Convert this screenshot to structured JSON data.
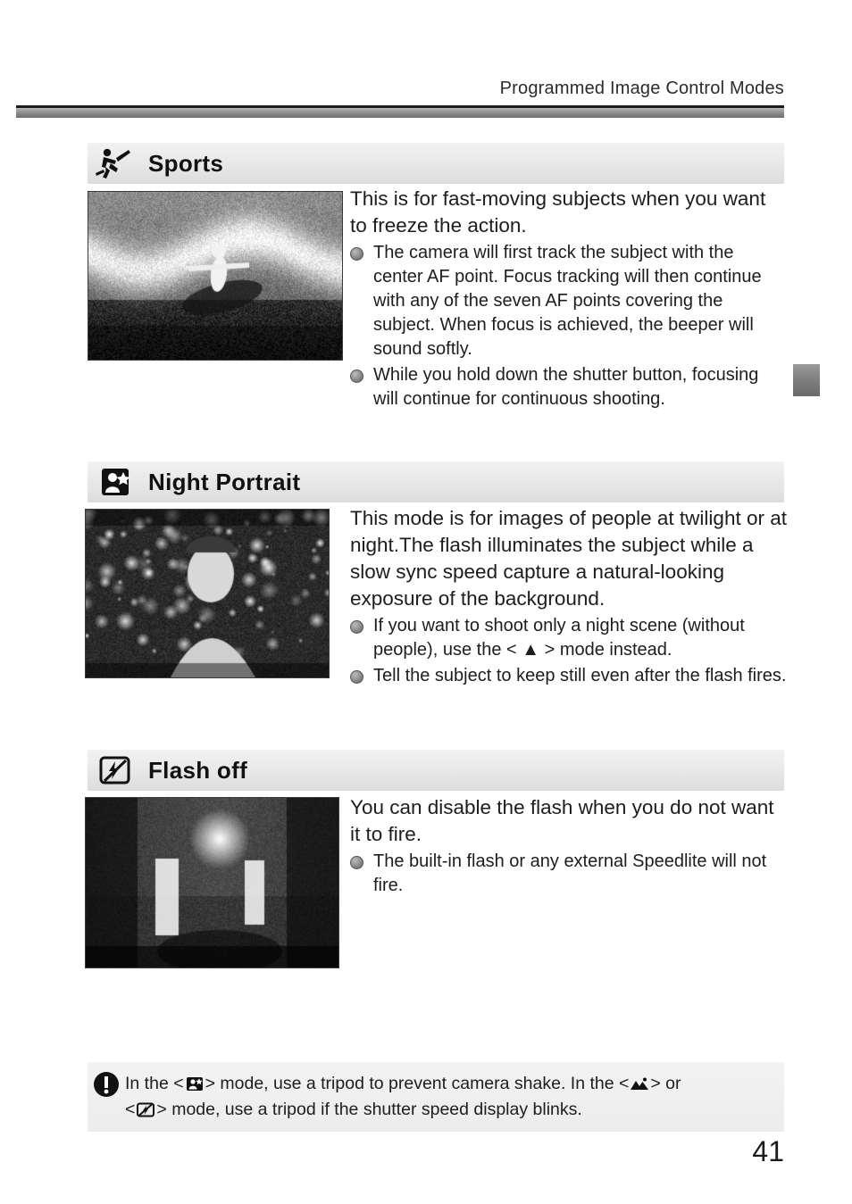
{
  "header": {
    "title": "Programmed Image Control Modes"
  },
  "sections": [
    {
      "id": "sports",
      "icon": "sports-runner-icon",
      "title": "Sports",
      "lead": "This is for fast-moving subjects when you want to freeze the action.",
      "bullets": [
        "The camera will first track the subject with the center AF point. Focus tracking will then continue with any of the seven AF points covering the subject. When focus is achieved, the beeper will sound softly.",
        "While you hold down the shutter button, focusing will continue for continuous shooting."
      ]
    },
    {
      "id": "night-portrait",
      "icon": "night-portrait-icon",
      "title": "Night Portrait",
      "lead": "This mode is for images of people at twilight or at night.The flash illuminates the subject while a slow sync speed capture a natural-looking exposure of the background.",
      "bullets": [
        "If you want to shoot only a night scene (without people), use the < ▲ > mode instead.",
        "Tell the subject to keep still even after the flash fires."
      ]
    },
    {
      "id": "flash-off",
      "icon": "flash-off-icon",
      "title": "Flash off",
      "lead": "You can disable the flash when you do not want it to fire.",
      "bullets": [
        "The built-in flash or any external Speedlite will not fire."
      ]
    }
  ],
  "note": {
    "icon": "warning-exclamation-icon",
    "line1_a": "In the <",
    "line1_icon1": "night-portrait-icon",
    "line1_b": "> mode,  use a tripod to prevent camera shake. In the  <",
    "line1_icon2": "landscape-icon",
    "line1_c": "> or",
    "line2_a": "<",
    "line2_icon1": "flash-off-icon",
    "line2_b": "> mode, use a tripod if the shutter speed display blinks."
  },
  "page_number": "41",
  "photos": {
    "sports_caption": "surfer-photo",
    "night_caption": "night-portrait-photo",
    "flashoff_caption": "interior-room-photo"
  },
  "colors": {
    "band_dark": "#6f6f6f",
    "band_light": "#b9b9b9",
    "heading_bg": "#e8e8e8",
    "text": "#1d1d1d"
  }
}
